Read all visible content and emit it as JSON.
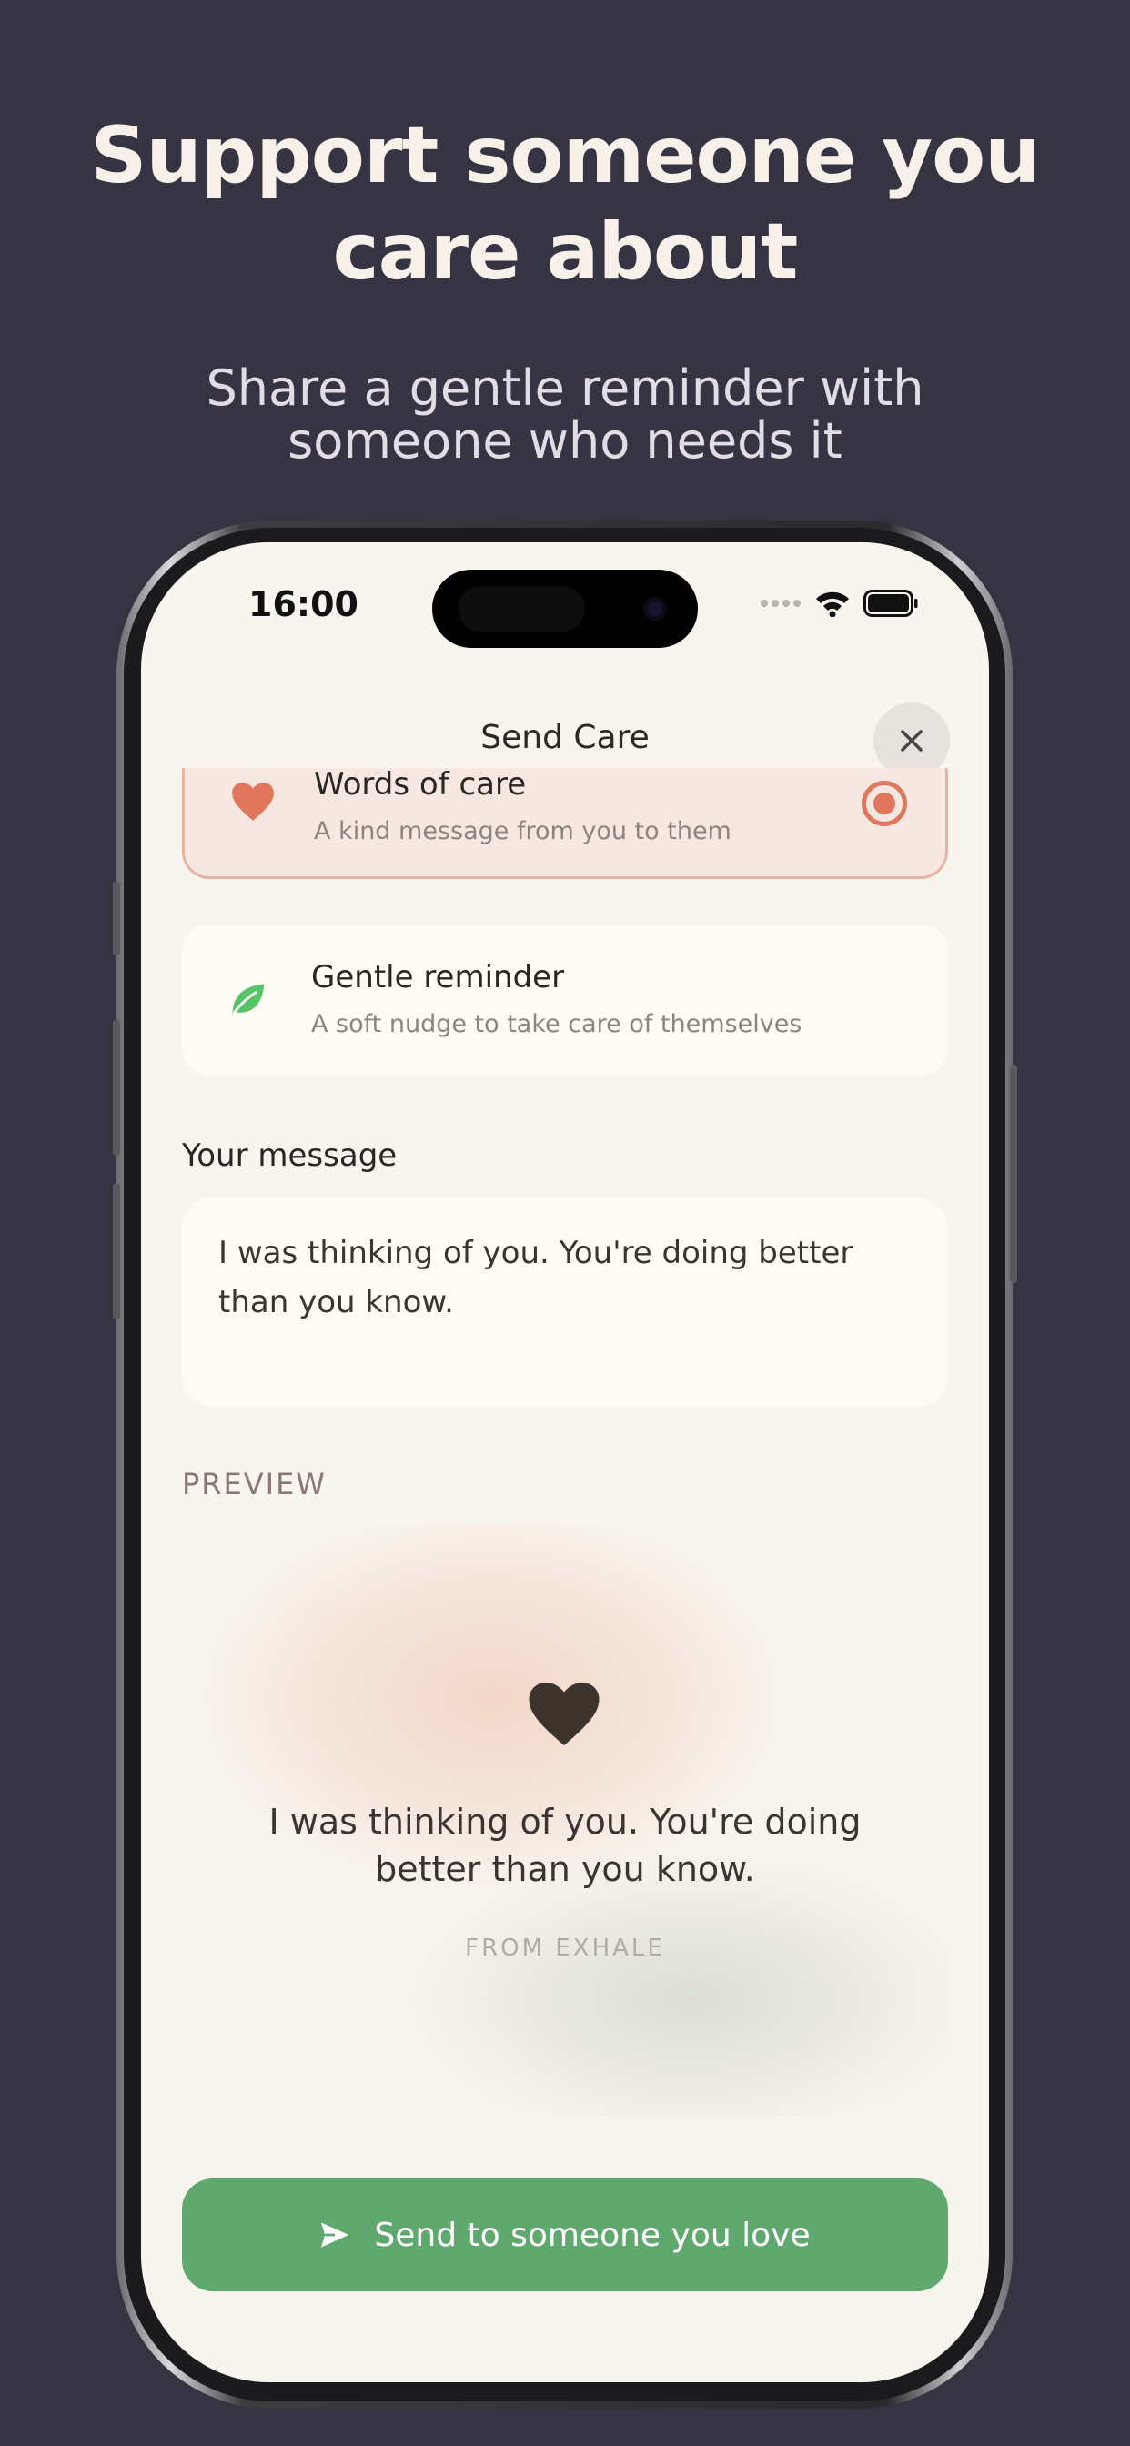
{
  "promo": {
    "headline_line1": "Support someone you",
    "headline_line2": "care about",
    "subheadline_line1": "Share a gentle reminder with",
    "subheadline_line2": "someone who needs it"
  },
  "status_bar": {
    "time": "16:00"
  },
  "sheet": {
    "title": "Send Care",
    "close_icon": "close-icon"
  },
  "options": [
    {
      "title": "Words of care",
      "description": "A kind message from you to them",
      "icon": "heart-icon",
      "selected": true,
      "accent": "#e0775c"
    },
    {
      "title": "Gentle reminder",
      "description": "A soft nudge to take care of themselves",
      "icon": "leaf-icon",
      "selected": false,
      "accent": "#58c46a"
    }
  ],
  "message": {
    "label": "Your message",
    "value": "I was thinking of you. You're doing better than you know."
  },
  "preview": {
    "label": "PREVIEW",
    "text": "I was thinking of you. You're doing better than you know.",
    "from": "FROM EXHALE",
    "icon": "heart-icon"
  },
  "send_button": {
    "label": "Send to someone you love",
    "icon": "send-icon",
    "color": "#5fa86e"
  },
  "colors": {
    "background": "#363442",
    "screen": "#f8f4ee",
    "selected_card": "#f6e7e1",
    "accent": "#e0775c"
  }
}
